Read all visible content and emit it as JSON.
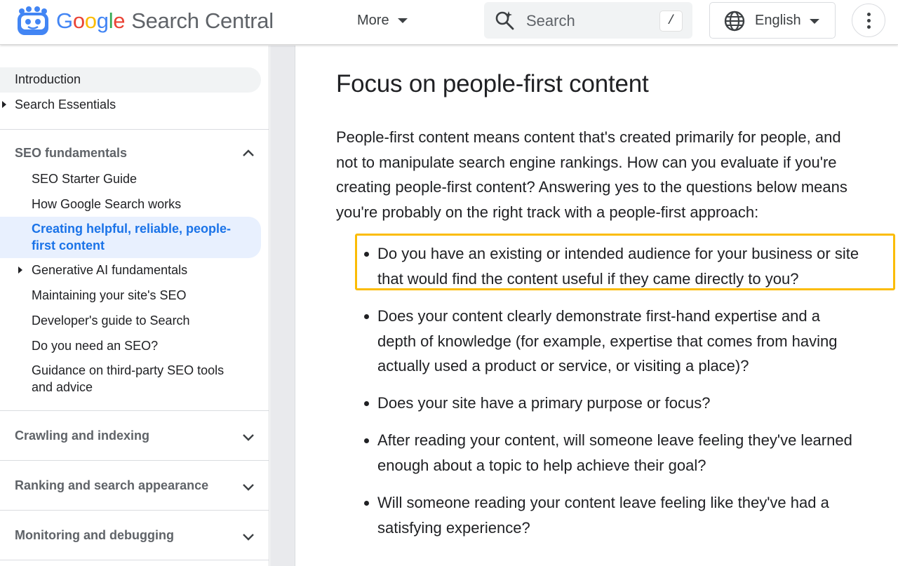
{
  "header": {
    "brand_google": [
      "G",
      "o",
      "o",
      "g",
      "l",
      "e"
    ],
    "brand_product": "Search Central",
    "more_label": "More",
    "search_placeholder": "Search",
    "search_shortcut": "/",
    "language": "English",
    "colors": {
      "blue": "#4285f4",
      "red": "#ea4335",
      "yellow": "#fbbc05",
      "green": "#34a853"
    }
  },
  "sidebar": {
    "top_items": [
      {
        "label": "Introduction"
      },
      {
        "label": "Search Essentials"
      }
    ],
    "section_seo": {
      "title": "SEO fundamentals",
      "items": [
        {
          "label": "SEO Starter Guide"
        },
        {
          "label": "How Google Search works"
        },
        {
          "label": "Creating helpful, reliable, people-first content",
          "line1": "Creating helpful, reliable, people-",
          "line2": "first content",
          "active": true
        },
        {
          "label": "Generative AI fundamentals"
        },
        {
          "label": "Maintaining your site's SEO"
        },
        {
          "label": "Developer's guide to Search"
        },
        {
          "label": "Do you need an SEO?"
        },
        {
          "label": "Guidance on third-party SEO tools and advice",
          "line1": "Guidance on third-party SEO tools",
          "line2": "and advice"
        }
      ]
    },
    "collapsed_sections": [
      {
        "title": "Crawling and indexing"
      },
      {
        "title": "Ranking and search appearance"
      },
      {
        "title": "Monitoring and debugging"
      }
    ],
    "active_color": "#1a73e8"
  },
  "main": {
    "title": "Focus on people-first content",
    "intro_lines": [
      "People-first content means content that's created primarily for people, and",
      "not to manipulate search engine rankings. How can you evaluate if you're",
      "creating people-first content? Answering yes to the questions below means",
      "you're probably on the right track with a people-first approach:"
    ],
    "bullets": [
      {
        "lines": [
          "Do you have an existing or intended audience for your business or site",
          "that would find the content useful if they came directly to you?"
        ]
      },
      {
        "lines": [
          "Does your content clearly demonstrate first-hand expertise and a",
          "depth of knowledge (for example, expertise that comes from having",
          "actually used a product or service, or visiting a place)?"
        ]
      },
      {
        "lines": [
          "Does your site have a primary purpose or focus?"
        ]
      },
      {
        "lines": [
          "After reading your content, will someone leave feeling they've learned",
          "enough about a topic to help achieve their goal?"
        ]
      },
      {
        "lines": [
          "Will someone reading your content leave feeling like they've had a",
          "satisfying experience?"
        ]
      }
    ],
    "highlight_color": "#fbbc05"
  }
}
